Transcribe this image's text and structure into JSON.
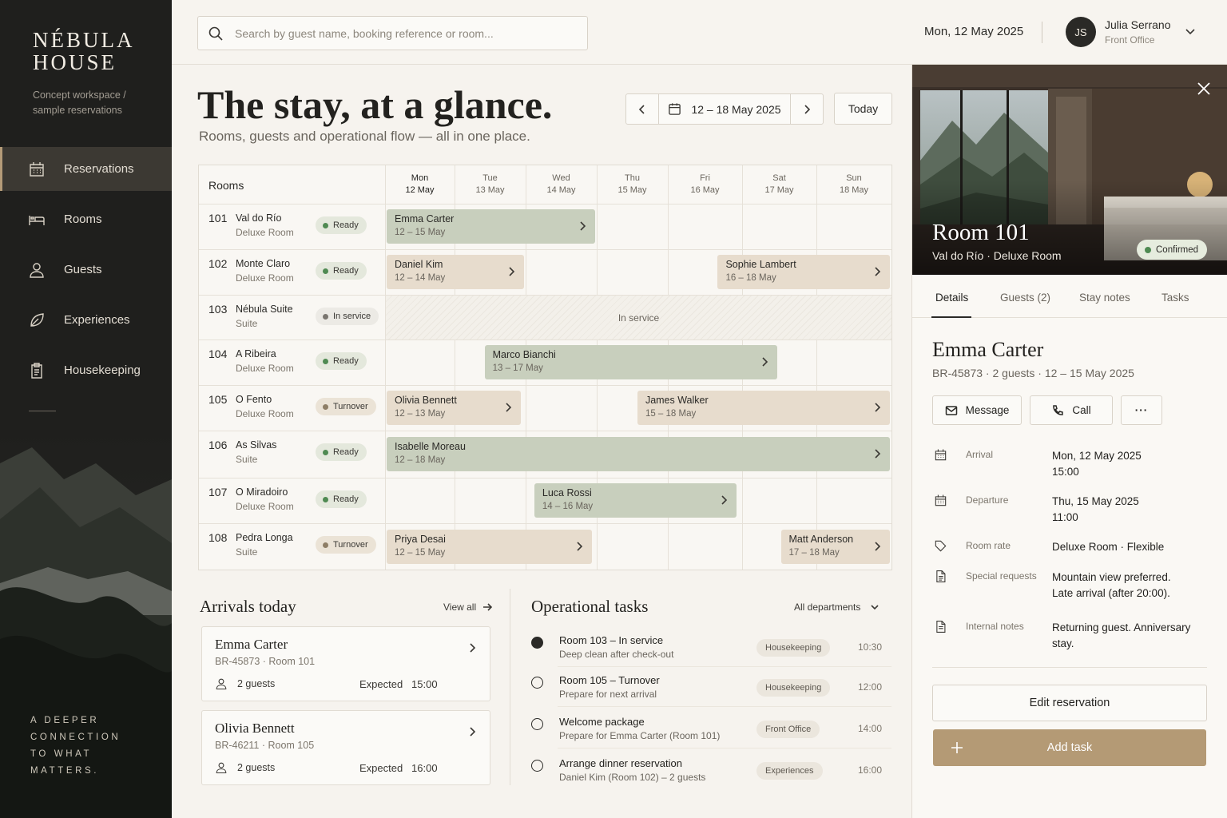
{
  "brand": {
    "line1": "NÉBULA",
    "line2": "HOUSE",
    "sub": "Concept workspace / sample reservations",
    "tagline_lines": [
      "A DEEPER",
      "CONNECTION",
      "TO WHAT",
      "MATTERS."
    ]
  },
  "nav": [
    {
      "label": "Reservations",
      "icon": "calendar-icon",
      "active": true
    },
    {
      "label": "Rooms",
      "icon": "bed-icon",
      "active": false
    },
    {
      "label": "Guests",
      "icon": "person-icon",
      "active": false
    },
    {
      "label": "Experiences",
      "icon": "leaf-icon",
      "active": false
    },
    {
      "label": "Housekeeping",
      "icon": "clipboard-icon",
      "active": false
    }
  ],
  "topbar": {
    "search_placeholder": "Search by guest name, booking reference or room...",
    "date": "Mon, 12 May 2025",
    "user_initials": "JS",
    "user_name": "Julia Serrano",
    "user_role": "Front Office"
  },
  "header": {
    "title": "The stay, at a glance.",
    "subtitle": "Rooms, guests and operational flow — all in one place.",
    "range": "12 – 18 May 2025",
    "today": "Today"
  },
  "calendar": {
    "rooms_label": "Rooms",
    "days": [
      {
        "dow": "Mon",
        "date": "12 May",
        "current": true
      },
      {
        "dow": "Tue",
        "date": "13 May",
        "current": false
      },
      {
        "dow": "Wed",
        "date": "14 May",
        "current": false
      },
      {
        "dow": "Thu",
        "date": "15 May",
        "current": false
      },
      {
        "dow": "Fri",
        "date": "16 May",
        "current": false
      },
      {
        "dow": "Sat",
        "date": "17 May",
        "current": false
      },
      {
        "dow": "Sun",
        "date": "18 May",
        "current": false
      }
    ],
    "rooms": [
      {
        "num": "101",
        "name": "Val do Río",
        "type": "Deluxe Room",
        "status": "Ready",
        "status_kind": "ready",
        "bookings": [
          {
            "guest": "Emma Carter",
            "dates": "12 – 15 May",
            "start": 0,
            "end": 3,
            "color": "green"
          }
        ]
      },
      {
        "num": "102",
        "name": "Monte Claro",
        "type": "Deluxe Room",
        "status": "Ready",
        "status_kind": "ready",
        "bookings": [
          {
            "guest": "Daniel Kim",
            "dates": "12 – 14 May",
            "start": 0,
            "end": 2,
            "color": "tan"
          },
          {
            "guest": "Sophie Lambert",
            "dates": "16 – 18 May",
            "start": 4.65,
            "end": 7,
            "color": "tan"
          }
        ]
      },
      {
        "num": "103",
        "name": "Nébula Suite",
        "type": "Suite",
        "status": "In service",
        "status_kind": "service",
        "service_label": "In service",
        "bookings": []
      },
      {
        "num": "104",
        "name": "A Ribeira",
        "type": "Deluxe Room",
        "status": "Ready",
        "status_kind": "ready",
        "bookings": [
          {
            "guest": "Marco Bianchi",
            "dates": "13 – 17 May",
            "start": 1.4,
            "end": 5.5,
            "color": "green"
          }
        ]
      },
      {
        "num": "105",
        "name": "O Fento",
        "type": "Deluxe Room",
        "status": "Turnover",
        "status_kind": "turnover",
        "bookings": [
          {
            "guest": "Olivia Bennett",
            "dates": "12 – 13 May",
            "start": 0,
            "end": 1.95,
            "color": "tan"
          },
          {
            "guest": "James Walker",
            "dates": "15 – 18 May",
            "start": 3.55,
            "end": 7,
            "color": "tan"
          }
        ]
      },
      {
        "num": "106",
        "name": "As Silvas",
        "type": "Suite",
        "status": "Ready",
        "status_kind": "ready",
        "bookings": [
          {
            "guest": "Isabelle Moreau",
            "dates": "12 – 18 May",
            "start": 0,
            "end": 7,
            "color": "green"
          }
        ]
      },
      {
        "num": "107",
        "name": "O Miradoiro",
        "type": "Deluxe Room",
        "status": "Ready",
        "status_kind": "ready",
        "bookings": [
          {
            "guest": "Luca Rossi",
            "dates": "14 – 16 May",
            "start": 2.1,
            "end": 4.95,
            "color": "green"
          }
        ]
      },
      {
        "num": "108",
        "name": "Pedra Longa",
        "type": "Suite",
        "status": "Turnover",
        "status_kind": "turnover",
        "bookings": [
          {
            "guest": "Priya Desai",
            "dates": "12 – 15 May",
            "start": 0,
            "end": 2.95,
            "color": "tan"
          },
          {
            "guest": "Matt Anderson",
            "dates": "17 – 18 May",
            "start": 5.5,
            "end": 7,
            "color": "tan"
          }
        ]
      }
    ]
  },
  "arrivals": {
    "title": "Arrivals today",
    "view_all": "View all",
    "items": [
      {
        "name": "Emma Carter",
        "ref": "BR-45873 · Room 101",
        "guests": "2 guests",
        "expected": "Expected   15:00"
      },
      {
        "name": "Olivia Bennett",
        "ref": "BR-46211 · Room 105",
        "guests": "2 guests",
        "expected": "Expected   16:00"
      }
    ]
  },
  "tasks": {
    "title": "Operational tasks",
    "filter": "All departments",
    "items": [
      {
        "title": "Room 103 – In service",
        "sub": "Deep clean after check-out",
        "tag": "Housekeeping",
        "time": "10:30",
        "done": true
      },
      {
        "title": "Room 105 – Turnover",
        "sub": "Prepare for next arrival",
        "tag": "Housekeeping",
        "time": "12:00",
        "done": false
      },
      {
        "title": "Welcome package",
        "sub": "Prepare for Emma Carter (Room 101)",
        "tag": "Front Office",
        "time": "14:00",
        "done": false
      },
      {
        "title": "Arrange dinner reservation",
        "sub": "Daniel Kim (Room 102) – 2 guests",
        "tag": "Experiences",
        "time": "16:00",
        "done": false
      }
    ]
  },
  "panel": {
    "room_title": "Room 101",
    "room_sub": "Val do Río  ·  Deluxe Room",
    "status": "Confirmed",
    "tabs": [
      "Details",
      "Guests (2)",
      "Stay notes",
      "Tasks"
    ],
    "guest_name": "Emma Carter",
    "guest_meta": "BR-45873  ·  2 guests  ·  12 – 15 May 2025",
    "actions": {
      "message": "Message",
      "call": "Call",
      "more": "···"
    },
    "details": [
      {
        "icon": "calendar-icon",
        "label": "Arrival",
        "value": "Mon, 12 May 2025\n15:00"
      },
      {
        "icon": "calendar-icon",
        "label": "Departure",
        "value": "Thu, 15 May 2025\n11:00"
      },
      {
        "icon": "tag-icon",
        "label": "Room rate",
        "value": "Deluxe Room  ·  Flexible"
      },
      {
        "icon": "document-icon",
        "label": "Special requests",
        "value": "Mountain view preferred.\nLate arrival (after 20:00)."
      },
      {
        "icon": "note-icon",
        "label": "Internal notes",
        "value": "Returning guest. Anniversary stay."
      }
    ],
    "edit": "Edit reservation",
    "add_task": "Add task"
  }
}
